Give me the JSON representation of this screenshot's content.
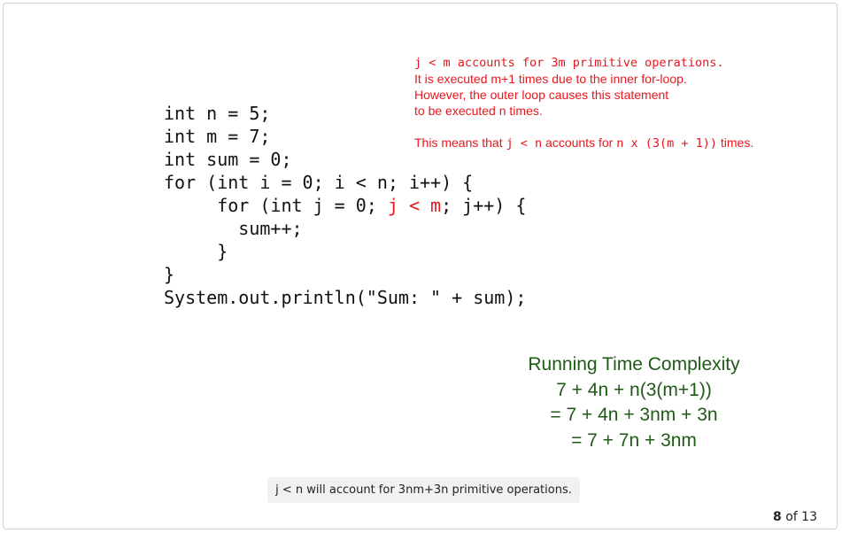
{
  "code": {
    "lines": [
      "int n = 5;",
      "int m = 7;",
      "int sum = 0;",
      "for (int i = 0; i < n; i++) {",
      "     for (int j = 0; ",
      "j < m",
      "; j++) {",
      "       sum++;",
      "     }",
      "}",
      "System.out.println(\"Sum: \" + sum);"
    ]
  },
  "annotation": {
    "line1": "j < m accounts for 3m primitive operations.",
    "line2": "It is executed m+1 times due to the inner for-loop.",
    "line3": "However, the outer loop causes this statement",
    "line4": "to be executed n times.",
    "line5_prefix": "This means that ",
    "line5_code1": "j < n",
    "line5_mid": " accounts for ",
    "line5_code2": "n x (3(m + 1))",
    "line5_suffix": " times."
  },
  "complexity": {
    "title": "Running Time Complexity",
    "lines": [
      "7 + 4n + n(3(m+1))",
      "= 7 + 4n + 3nm + 3n",
      "= 7 + 7n + 3nm"
    ]
  },
  "caption": "j < n will account for 3nm+3n primitive operations.",
  "pager": {
    "current": "8",
    "separator": "of",
    "total": "13"
  },
  "colors": {
    "highlight": "#e8161c",
    "complexity": "#1f5a17"
  }
}
